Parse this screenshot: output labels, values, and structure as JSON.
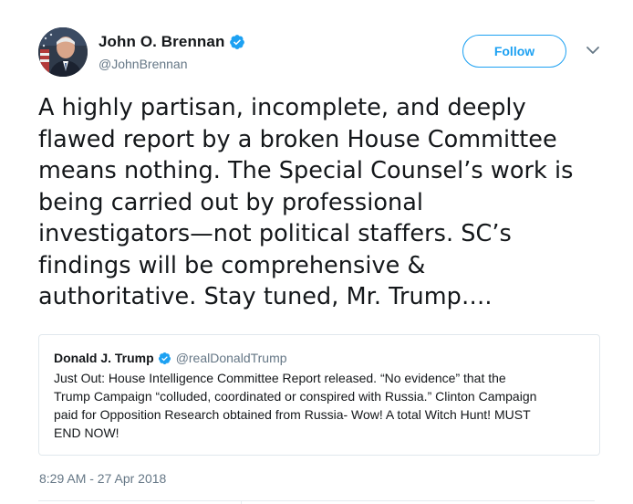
{
  "author": {
    "display_name": "John O. Brennan",
    "handle": "@JohnBrennan",
    "verified": true
  },
  "follow_button": {
    "label": "Follow"
  },
  "tweet": {
    "lines": [
      "A highly partisan, incomplete, and deeply",
      "flawed report by a broken House Committee",
      "means nothing. The Special Counsel’s work is",
      "being carried out by professional",
      "investigators—not political staffers. SC’s",
      "findings will be comprehensive &",
      "authoritative. Stay tuned, Mr. Trump…."
    ],
    "timestamp": "8:29 AM - 27 Apr 2018"
  },
  "quoted_tweet": {
    "display_name": "Donald J. Trump",
    "handle": "@realDonaldTrump",
    "verified": true,
    "lines": [
      "Just Out: House Intelligence Committee Report released. “No evidence” that the",
      "Trump Campaign “colluded, coordinated or conspired with Russia.” Clinton Campaign",
      "paid for Opposition Research obtained from Russia- Wow! A total Witch Hunt! MUST",
      "END NOW!"
    ]
  },
  "icons": {
    "verified": "verified-badge-icon",
    "caret": "chevron-down-icon"
  },
  "colors": {
    "brand_blue": "#1da1f2",
    "text_primary": "#14171a",
    "text_secondary": "#657786",
    "border": "#e1e8ed"
  }
}
